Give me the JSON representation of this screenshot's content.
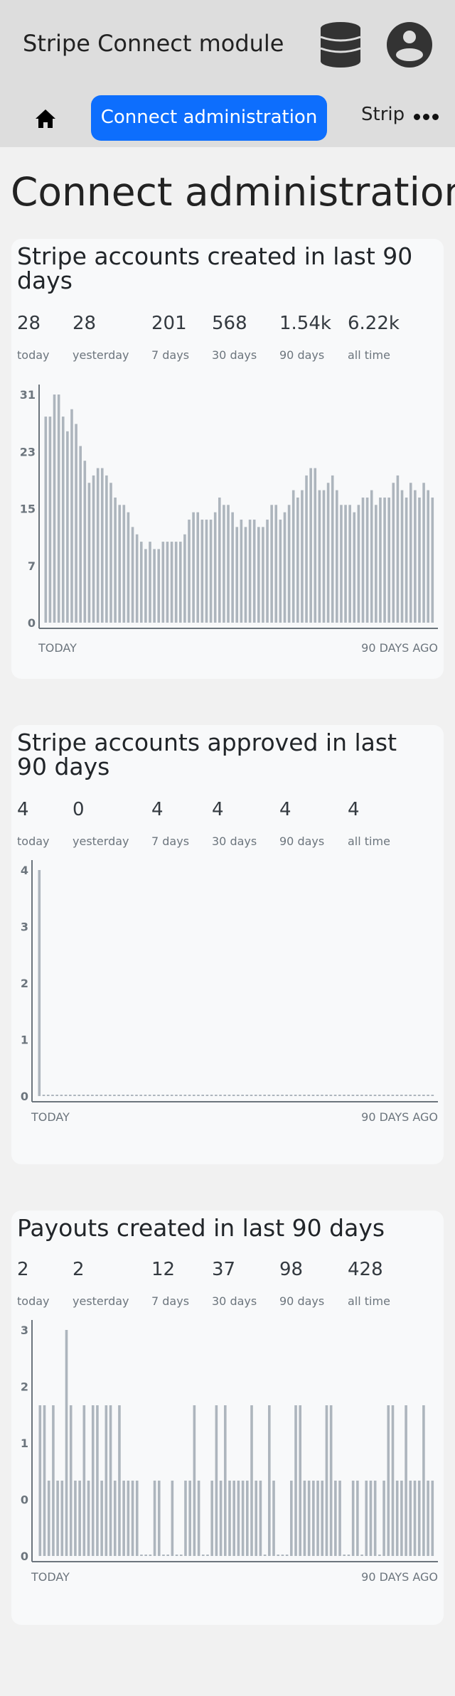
{
  "header": {
    "app_title": "Stripe Connect module",
    "database_icon": "database-icon",
    "user_icon": "user-circle-icon"
  },
  "nav": {
    "home_icon": "home-icon",
    "active_label": "Connect administration",
    "next_label": "Strip",
    "more_icon": "ellipsis-icon"
  },
  "page_title": "Connect administration",
  "cards": [
    {
      "title": "Stripe accounts created in last 90 days",
      "stats": [
        {
          "value": "28",
          "label": "today"
        },
        {
          "value": "28",
          "label": "yesterday"
        },
        {
          "value": "201",
          "label": "7 days"
        },
        {
          "value": "568",
          "label": "30 days"
        },
        {
          "value": "1.54k",
          "label": "90 days"
        },
        {
          "value": "6.22k",
          "label": "all time"
        }
      ],
      "x_start": "TODAY",
      "x_end": "90 DAYS AGO"
    },
    {
      "title": "Stripe accounts approved in last 90 days",
      "stats": [
        {
          "value": "4",
          "label": "today"
        },
        {
          "value": "0",
          "label": "yesterday"
        },
        {
          "value": "4",
          "label": "7 days"
        },
        {
          "value": "4",
          "label": "30 days"
        },
        {
          "value": "4",
          "label": "90 days"
        },
        {
          "value": "4",
          "label": "all time"
        }
      ],
      "x_start": "TODAY",
      "x_end": "90 DAYS AGO"
    },
    {
      "title": "Payouts created in last 90 days",
      "stats": [
        {
          "value": "2",
          "label": "today"
        },
        {
          "value": "2",
          "label": "yesterday"
        },
        {
          "value": "12",
          "label": "7 days"
        },
        {
          "value": "37",
          "label": "30 days"
        },
        {
          "value": "98",
          "label": "90 days"
        },
        {
          "value": "428",
          "label": "all time"
        }
      ],
      "x_start": "TODAY",
      "x_end": "90 DAYS AGO"
    }
  ],
  "chart_data": [
    {
      "type": "bar",
      "title": "Stripe accounts created in last 90 days",
      "xlabel": "",
      "ylabel": "",
      "ylim": [
        0,
        31
      ],
      "yticks": [
        "31",
        "23",
        "15",
        "7",
        "0"
      ],
      "bar_color": "#adb5bd",
      "values": [
        28,
        28,
        31,
        31,
        28,
        26,
        29,
        27,
        24,
        22,
        19,
        20,
        21,
        21,
        20,
        19,
        17,
        16,
        16,
        15,
        13,
        12,
        11,
        10,
        11,
        10,
        10,
        11,
        11,
        11,
        11,
        11,
        12,
        14,
        15,
        15,
        14,
        14,
        14,
        15,
        17,
        16,
        16,
        15,
        13,
        14,
        13,
        14,
        14,
        13,
        13,
        14,
        16,
        16,
        14,
        15,
        16,
        18,
        17,
        18,
        20,
        21,
        21,
        18,
        18,
        19,
        20,
        18,
        16,
        16,
        16,
        15,
        16,
        17,
        17,
        18,
        16,
        17,
        17,
        17,
        19,
        20,
        18,
        17,
        19,
        18,
        17,
        19,
        18,
        17
      ]
    },
    {
      "type": "bar",
      "title": "Stripe accounts approved in last 90 days",
      "xlabel": "",
      "ylabel": "",
      "ylim": [
        0,
        4
      ],
      "yticks": [
        "4",
        "3",
        "2",
        "1",
        "0"
      ],
      "bar_color": "#adb5bd",
      "values": [
        4,
        0,
        0,
        0,
        0,
        0,
        0,
        0,
        0,
        0,
        0,
        0,
        0,
        0,
        0,
        0,
        0,
        0,
        0,
        0,
        0,
        0,
        0,
        0,
        0,
        0,
        0,
        0,
        0,
        0,
        0,
        0,
        0,
        0,
        0,
        0,
        0,
        0,
        0,
        0,
        0,
        0,
        0,
        0,
        0,
        0,
        0,
        0,
        0,
        0,
        0,
        0,
        0,
        0,
        0,
        0,
        0,
        0,
        0,
        0,
        0,
        0,
        0,
        0,
        0,
        0,
        0,
        0,
        0,
        0,
        0,
        0,
        0,
        0,
        0,
        0,
        0,
        0,
        0,
        0,
        0,
        0,
        0,
        0,
        0,
        0,
        0,
        0,
        0,
        0
      ]
    },
    {
      "type": "bar",
      "title": "Payouts created in last 90 days",
      "xlabel": "",
      "ylabel": "",
      "ylim": [
        0,
        3
      ],
      "yticks": [
        "3",
        "2",
        "1",
        "0",
        "0"
      ],
      "bar_color": "#adb5bd",
      "values": [
        2,
        2,
        1,
        2,
        1,
        1,
        3,
        2,
        1,
        1,
        2,
        1,
        2,
        2,
        1,
        2,
        2,
        1,
        2,
        1,
        1,
        1,
        1,
        0,
        0,
        0,
        1,
        1,
        0,
        0,
        1,
        0,
        0,
        1,
        1,
        2,
        1,
        0,
        0,
        1,
        2,
        1,
        2,
        1,
        1,
        1,
        1,
        1,
        2,
        1,
        1,
        0,
        2,
        1,
        0,
        0,
        0,
        1,
        2,
        2,
        1,
        1,
        1,
        1,
        1,
        2,
        2,
        1,
        1,
        0,
        0,
        1,
        1,
        0,
        1,
        1,
        1,
        0,
        1,
        2,
        2,
        1,
        1,
        2,
        1,
        1,
        1,
        2,
        1,
        1
      ]
    }
  ]
}
